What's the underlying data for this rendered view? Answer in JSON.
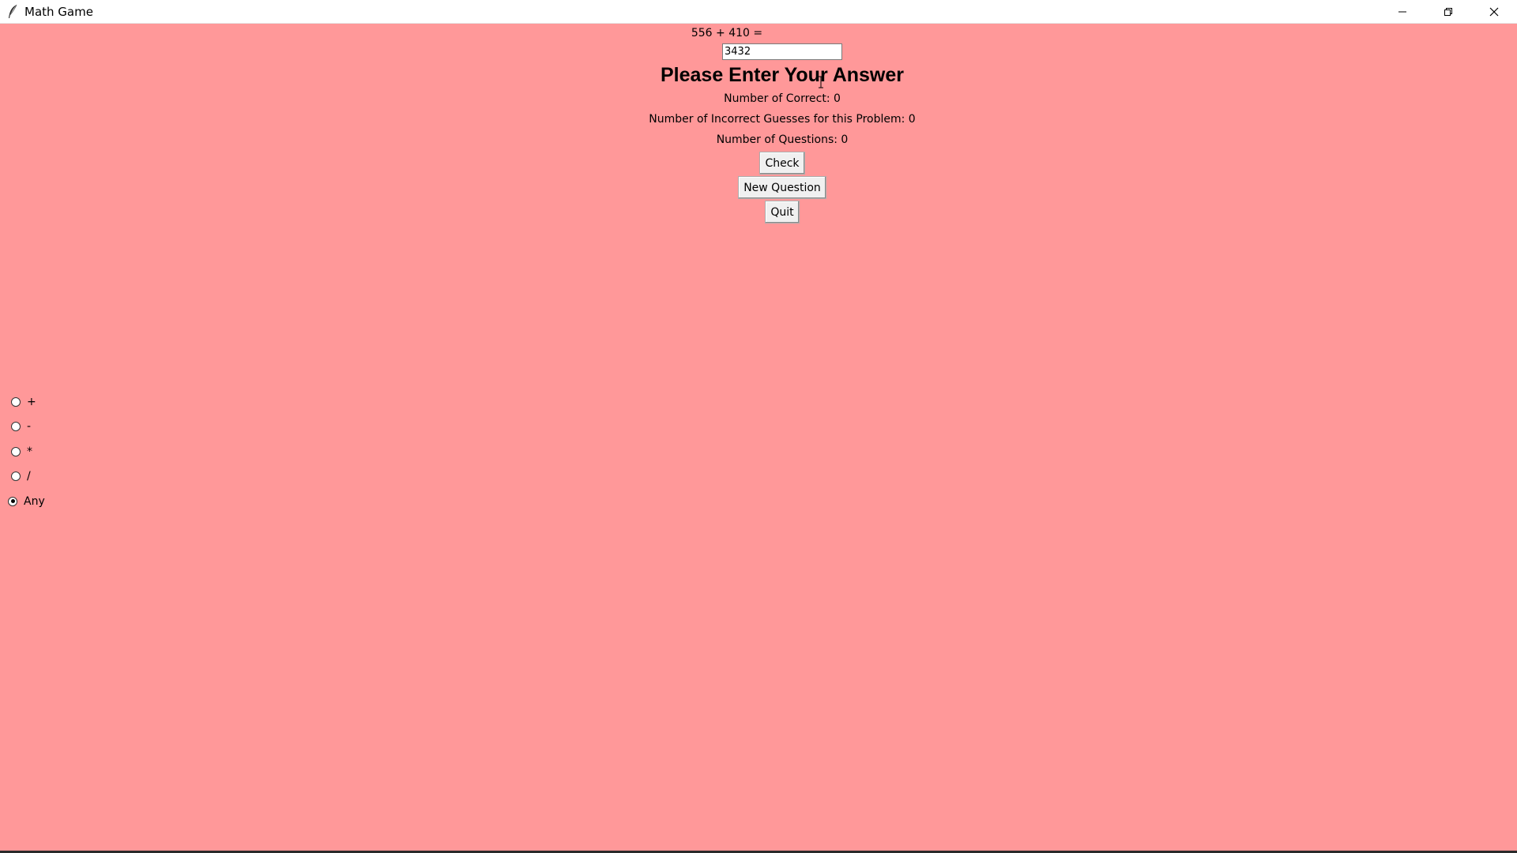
{
  "window": {
    "title": "Math Game",
    "background": "#ff9899"
  },
  "game": {
    "problem": "556 + 410 =",
    "answer_value": "3432",
    "prompt": "Please Enter Your Answer",
    "correct_text": "Number of Correct: 0",
    "incorrect_text": "Number of Incorrect Guesses for this Problem: 0",
    "questions_text": "Number of Questions: 0"
  },
  "buttons": {
    "check": "Check",
    "new_question": "New Question",
    "quit": "Quit"
  },
  "operations": [
    {
      "label": "+",
      "checked": false
    },
    {
      "label": "-",
      "checked": false
    },
    {
      "label": "*",
      "checked": false
    },
    {
      "label": "/",
      "checked": false
    },
    {
      "label": "Any",
      "checked": true
    }
  ],
  "icons": {
    "app": "feather-icon",
    "minimize": "minimize-icon",
    "restore": "restore-icon",
    "close": "close-icon"
  }
}
